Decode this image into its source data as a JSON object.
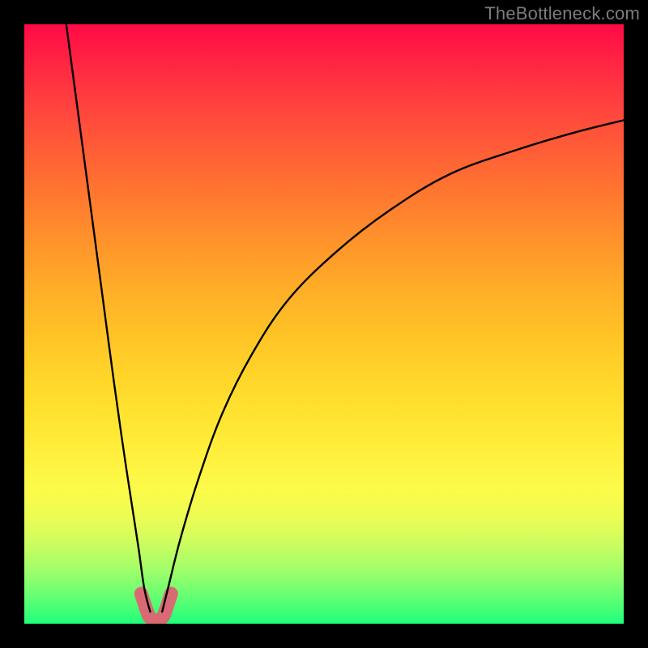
{
  "watermark": "TheBottleneck.com",
  "chart_data": {
    "type": "line",
    "title": "",
    "xlabel": "",
    "ylabel": "",
    "xlim": [
      0,
      100
    ],
    "ylim": [
      0,
      100
    ],
    "minimum_x": 22,
    "left_branch": [
      {
        "x": 7,
        "y": 100
      },
      {
        "x": 9,
        "y": 85
      },
      {
        "x": 11,
        "y": 70
      },
      {
        "x": 13,
        "y": 55
      },
      {
        "x": 15,
        "y": 40
      },
      {
        "x": 17,
        "y": 26
      },
      {
        "x": 19,
        "y": 13
      },
      {
        "x": 20,
        "y": 6
      },
      {
        "x": 21,
        "y": 2
      }
    ],
    "right_branch": [
      {
        "x": 23,
        "y": 2
      },
      {
        "x": 24,
        "y": 6
      },
      {
        "x": 26,
        "y": 14
      },
      {
        "x": 29,
        "y": 24
      },
      {
        "x": 33,
        "y": 35
      },
      {
        "x": 38,
        "y": 45
      },
      {
        "x": 44,
        "y": 54
      },
      {
        "x": 52,
        "y": 62
      },
      {
        "x": 61,
        "y": 69
      },
      {
        "x": 71,
        "y": 75
      },
      {
        "x": 82,
        "y": 79
      },
      {
        "x": 92,
        "y": 82
      },
      {
        "x": 100,
        "y": 84
      }
    ],
    "highlight_zone": [
      {
        "x": 19.5,
        "y": 5
      },
      {
        "x": 20.5,
        "y": 2
      },
      {
        "x": 21.0,
        "y": 1
      },
      {
        "x": 22.0,
        "y": 0.5
      },
      {
        "x": 23.0,
        "y": 1
      },
      {
        "x": 23.5,
        "y": 2
      },
      {
        "x": 24.5,
        "y": 5
      }
    ],
    "colors": {
      "curve": "#000000",
      "highlight": "#d96a74",
      "frame": "#000000"
    }
  }
}
